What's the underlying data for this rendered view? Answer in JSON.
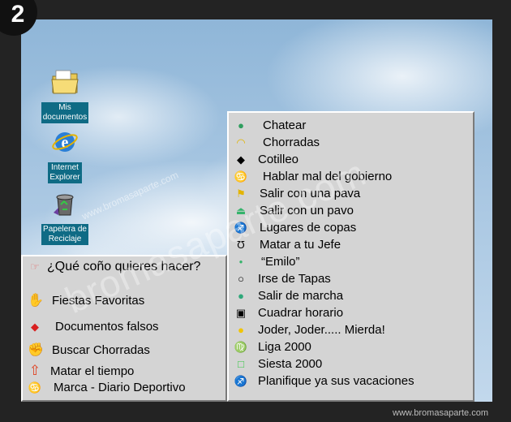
{
  "step_badge": "2",
  "desktop": {
    "icons": [
      {
        "label": "Mis\ndocumentos",
        "icon": "folder-icon"
      },
      {
        "label": "Internet\nExplorer",
        "icon": "internet-explorer-icon"
      },
      {
        "label": "Papelera de\nReciclaje",
        "icon": "recycle-bin-icon"
      }
    ]
  },
  "left_menu": {
    "title": "¿Qué coño quieres hacer?",
    "items": [
      {
        "label": "Fiestas Favoritas",
        "icon": "hand-icon",
        "color": "#35b36b"
      },
      {
        "label": "Documentos falsos",
        "icon": "diamond-icon",
        "color": "#d92020"
      },
      {
        "label": "Buscar Chorradas",
        "icon": "hand-grab-icon",
        "color": "#e3b400"
      },
      {
        "label": "Matar el tiempo",
        "icon": "arrow-up-icon",
        "color": "#e04020"
      },
      {
        "label": "Marca - Diario Deportivo",
        "icon": "cancer-sign-icon",
        "color": "#000000"
      }
    ]
  },
  "right_menu": {
    "items": [
      {
        "label": "Chatear",
        "icon": "bomb-icon",
        "color": "#2f9e5e"
      },
      {
        "label": "Chorradas",
        "icon": "arc-icon",
        "color": "#e3b400"
      },
      {
        "label": "Cotilleo",
        "icon": "diamond-icon",
        "color": "#000000"
      },
      {
        "label": "Hablar mal del gobierno",
        "icon": "cancer-sign-icon",
        "color": "#000000"
      },
      {
        "label": "Salir con una pava",
        "icon": "flag-icon",
        "color": "#e3b400"
      },
      {
        "label": "Salir con un pavo",
        "icon": "bell-icon",
        "color": "#35b36b"
      },
      {
        "label": "Lugares de copas",
        "icon": "sagittarius-icon",
        "color": "#3a52c8"
      },
      {
        "label": "Matar a tu Jefe",
        "icon": "cup-icon",
        "color": "#000000"
      },
      {
        "label": "“Emilo”",
        "icon": "dot-icon",
        "color": "#35b36b"
      },
      {
        "label": "Irse de Tapas",
        "icon": "circle-icon",
        "color": "#000000"
      },
      {
        "label": "Salir de marcha",
        "icon": "green-dot-icon",
        "color": "#2fa87a"
      },
      {
        "label": "Cuadrar horario",
        "icon": "square-icon",
        "color": "#000000"
      },
      {
        "label": "Joder, Joder..... Mierda!",
        "icon": "yellow-dot-icon",
        "color": "#f1c400"
      },
      {
        "label": "Liga 2000",
        "icon": "virgo-icon",
        "color": "#e04020"
      },
      {
        "label": "Siesta 2000",
        "icon": "green-square-icon",
        "color": "#35c845"
      },
      {
        "label": "Planifique ya sus vacaciones",
        "icon": "sagittarius-icon",
        "color": "#3a52c8"
      }
    ]
  },
  "watermark": "bromasaparte.com",
  "watermark_small": "www.bromasaparte.com",
  "footer_url": "www.bromasaparte.com"
}
